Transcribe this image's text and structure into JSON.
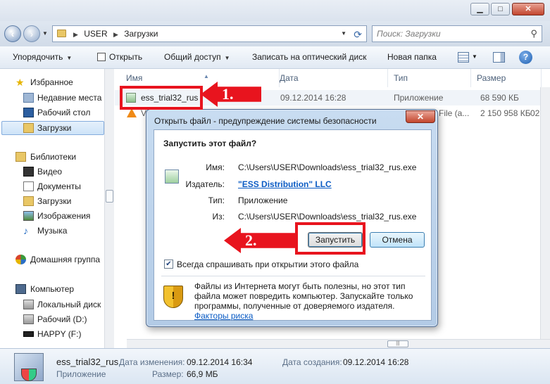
{
  "window": {
    "buttons": {
      "minimize": "▁",
      "maximize": "□",
      "close": "✕"
    }
  },
  "address": {
    "crumbs": [
      "USER",
      "Загрузки"
    ],
    "search_placeholder": "Поиск: Загрузки"
  },
  "toolbar": {
    "organize": "Упорядочить",
    "open": "Открыть",
    "share": "Общий доступ",
    "burn": "Записать на оптический диск",
    "new_folder": "Новая папка"
  },
  "nav": {
    "favorites": "Избранное",
    "recent": "Недавние места",
    "desktop": "Рабочий стол",
    "downloads": "Загрузки",
    "libraries": "Библиотеки",
    "video": "Видео",
    "documents": "Документы",
    "lib_downloads": "Загрузки",
    "images": "Изображения",
    "music": "Музыка",
    "homegroup": "Домашняя группа",
    "computer": "Компьютер",
    "local_disk": "Локальный диск",
    "work_d": "Рабочий (D:)",
    "happy_f": "HAPPY (F:)"
  },
  "columns": {
    "name": "Имя",
    "date": "Дата",
    "type": "Тип",
    "size": "Размер"
  },
  "files": [
    {
      "name": "ess_trial32_rus",
      "date": "09.12.2014 16:28",
      "type": "Приложение",
      "size": "68 590 КБ"
    },
    {
      "name": "V",
      "date": "",
      "type": "File (a...",
      "size": "2 150 958 КБ",
      "extra": "02"
    }
  ],
  "details": {
    "name": "ess_trial32_rus",
    "type": "Приложение",
    "modified_label": "Дата изменения:",
    "modified": "09.12.2014 16:34",
    "size_label": "Размер:",
    "size": "66,9 МБ",
    "created_label": "Дата создания:",
    "created": "09.12.2014 16:28"
  },
  "dialog": {
    "title": "Открыть файл - предупреждение системы безопасности",
    "close": "✕",
    "heading": "Запустить этот файл?",
    "name_label": "Имя:",
    "name": "C:\\Users\\USER\\Downloads\\ess_trial32_rus.exe",
    "publisher_label": "Издатель:",
    "publisher": "\"ESS Distribution\" LLC",
    "type_label": "Тип:",
    "type": "Приложение",
    "from_label": "Из:",
    "from": "C:\\Users\\USER\\Downloads\\ess_trial32_rus.exe",
    "run": "Запустить",
    "cancel": "Отмена",
    "always_ask": "Всегда спрашивать при открытии этого файла",
    "always_ask_checked": true,
    "warning": "Файлы из Интернета могут быть полезны, но этот тип файла может повредить компьютер. Запускайте только программы, полученные от доверяемого издателя.",
    "risk_link": "Факторы риска"
  },
  "annotations": {
    "step1": "1.",
    "step2": "2.",
    "color": "#e8141e"
  }
}
